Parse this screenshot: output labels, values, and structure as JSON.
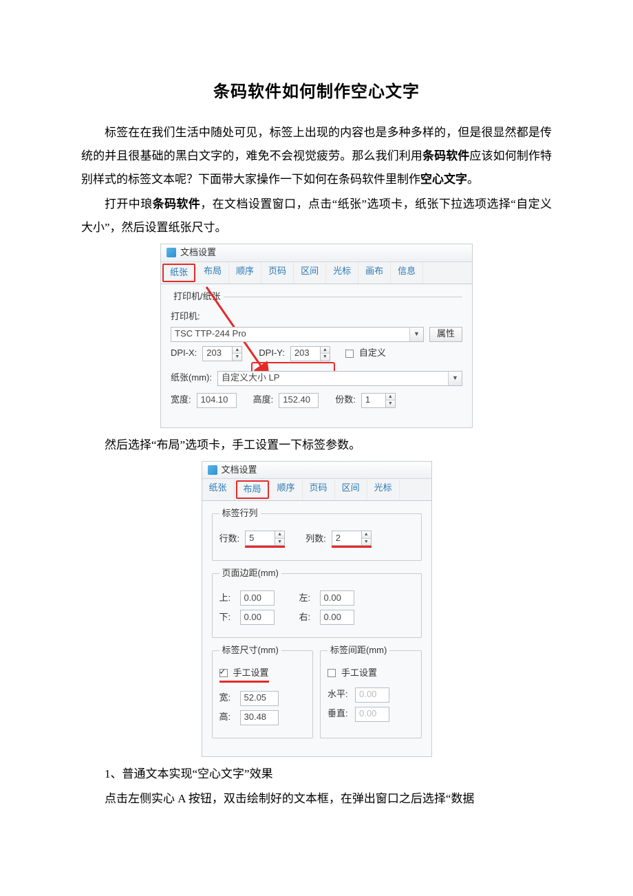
{
  "title": "条码软件如何制作空心文字",
  "para1a": "标签在在我们生活中随处可见，标签上出现的内容也是多种多样的，但是很显然都是传统的并且很基础的黑白文字的，难免不会视觉疲劳。那么我们利用",
  "para1b": "条码软件",
  "para1c": "应该如何制作特别样式的标签文本呢？下面带大家操作一下如何在条码软件里制作",
  "para1d": "空心文字",
  "para1e": "。",
  "para2a": "打开中琅",
  "para2b": "条码软件",
  "para2c": "，在文档设置窗口，点击“纸张”选项卡，纸张下拉选项选择“自定义大小”，然后设置纸张尺寸。",
  "dlg1": {
    "title": "文档设置",
    "tabs": [
      "纸张",
      "布局",
      "顺序",
      "页码",
      "区间",
      "光标",
      "画布",
      "信息"
    ],
    "grp1legend": "打印机/纸张",
    "printer_label": "打印机:",
    "printer_value": "TSC TTP-244 Pro",
    "prop_btn": "属性",
    "dpix_label": "DPI-X:",
    "dpix_value": "203",
    "dpiy_label": "DPI-Y:",
    "dpiy_value": "203",
    "custom_chk": "自定义",
    "paper_label": "纸张(mm):",
    "paper_value": "自定义大小 LP",
    "width_label": "宽度:",
    "width_value": "104.10",
    "height_label": "高度:",
    "height_value": "152.40",
    "copies_label": "份数:",
    "copies_value": "1"
  },
  "para3": "然后选择“布局”选项卡，手工设置一下标签参数。",
  "dlg2": {
    "title": "文档设置",
    "tabs": [
      "纸张",
      "布局",
      "顺序",
      "页码",
      "区间",
      "光标"
    ],
    "grp_rows_legend": "标签行列",
    "rows_label": "行数:",
    "rows_value": "5",
    "cols_label": "列数:",
    "cols_value": "2",
    "grp_margin_legend": "页面边距(mm)",
    "m_top_label": "上:",
    "m_top_value": "0.00",
    "m_left_label": "左:",
    "m_left_value": "0.00",
    "m_bottom_label": "下:",
    "m_bottom_value": "0.00",
    "m_right_label": "右:",
    "m_right_value": "0.00",
    "grp_size_legend": "标签尺寸(mm)",
    "chk_manual": "手工设置",
    "size_w_label": "宽:",
    "size_w_value": "52.05",
    "size_h_label": "高:",
    "size_h_value": "30.48",
    "grp_gap_legend": "标签间距(mm)",
    "gap_h_label": "水平:",
    "gap_h_value": "0.00",
    "gap_v_label": "垂直:",
    "gap_v_value": "0.00"
  },
  "para4": "1、普通文本实现“空心文字”效果",
  "para5": "点击左侧实心 A 按钮，双击绘制好的文本框，在弹出窗口之后选择“数据"
}
